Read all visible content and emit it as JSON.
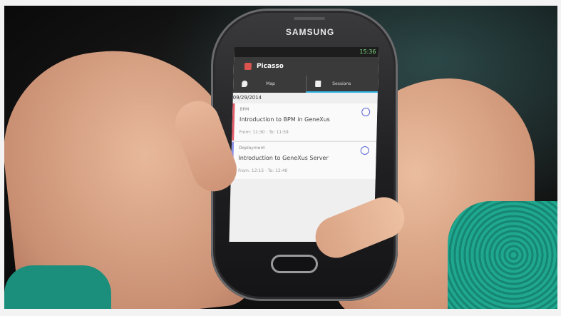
{
  "phone": {
    "brand": "SAMSUNG"
  },
  "app": {
    "title": "Picasso",
    "status_time": "15:36"
  },
  "tabs": [
    {
      "label": "Map",
      "icon": "map-pin-icon"
    },
    {
      "label": "Sessions",
      "icon": "calendar-icon"
    }
  ],
  "date_header": "09/29/2014",
  "sessions": [
    {
      "track": "BPM",
      "title": "Introduction to BPM in GeneXus",
      "time": "From: 11:30  ·  To: 11:59",
      "color": "#e35d6a"
    },
    {
      "track": "Deployment",
      "title": "Introduction to GeneXus Server",
      "time": "From: 12:15  ·  To: 12:40",
      "color": "#8a8fe8"
    }
  ]
}
